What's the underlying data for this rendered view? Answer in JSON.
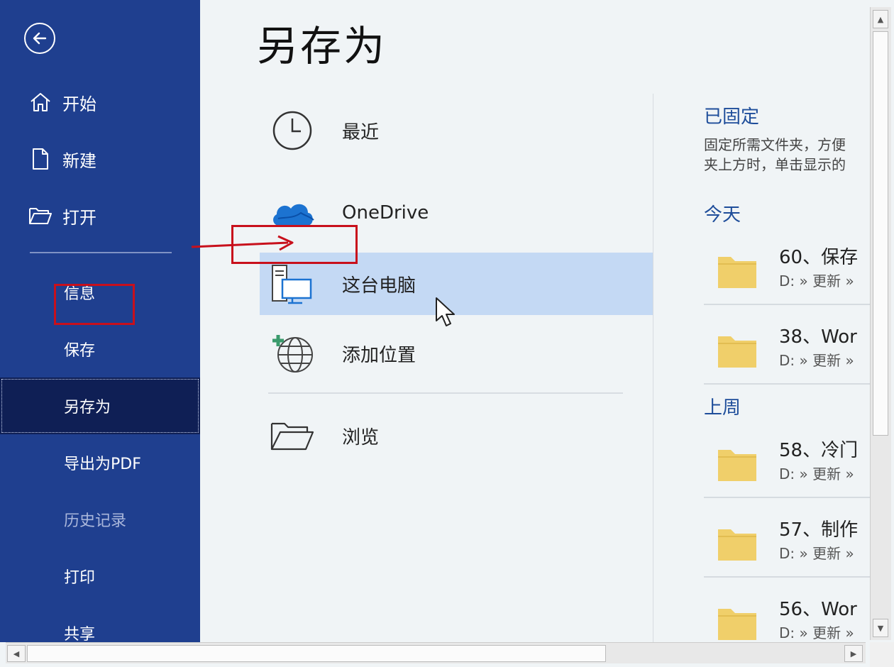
{
  "sidebar": {
    "top_items": [
      {
        "label": "开始",
        "icon": "home-icon"
      },
      {
        "label": "新建",
        "icon": "new-document-icon"
      },
      {
        "label": "打开",
        "icon": "open-folder-icon"
      }
    ],
    "bottom_items": [
      {
        "label": "信息",
        "state": "normal"
      },
      {
        "label": "保存",
        "state": "normal"
      },
      {
        "label": "另存为",
        "state": "active"
      },
      {
        "label": "导出为PDF",
        "state": "normal"
      },
      {
        "label": "历史记录",
        "state": "disabled"
      },
      {
        "label": "打印",
        "state": "normal"
      },
      {
        "label": "共享",
        "state": "normal"
      }
    ]
  },
  "main": {
    "title": "另存为",
    "locations": [
      {
        "label": "最近",
        "icon": "clock-icon"
      },
      {
        "label": "OneDrive",
        "icon": "onedrive-cloud-icon"
      },
      {
        "label": "这台电脑",
        "icon": "this-pc-icon",
        "selected": true
      },
      {
        "label": "添加位置",
        "icon": "add-place-globe-icon"
      },
      {
        "label": "浏览",
        "icon": "browse-folder-icon"
      }
    ]
  },
  "right": {
    "pinned_title": "已固定",
    "pinned_desc_line1": "固定所需文件夹，方便",
    "pinned_desc_line2": "夹上方时，单击显示的",
    "today_title": "今天",
    "last_week_title": "上周",
    "today_files": [
      {
        "name": "60、保存",
        "path": "D: » 更新 »"
      },
      {
        "name": "38、Wor",
        "path": "D: » 更新 »"
      }
    ],
    "last_week_files": [
      {
        "name": "58、冷门",
        "path": "D: » 更新 »"
      },
      {
        "name": "57、制作",
        "path": "D: » 更新 »"
      },
      {
        "name": "56、Wor",
        "path": "D: » 更新 »"
      }
    ]
  },
  "colors": {
    "sidebar_bg": "#1f3f8f",
    "sidebar_active": "#0f1f55",
    "selected_bg": "#c4d9f4",
    "section_title": "#1e4d9a",
    "folder": "#f0cf6a",
    "annotation": "#c8101c"
  }
}
